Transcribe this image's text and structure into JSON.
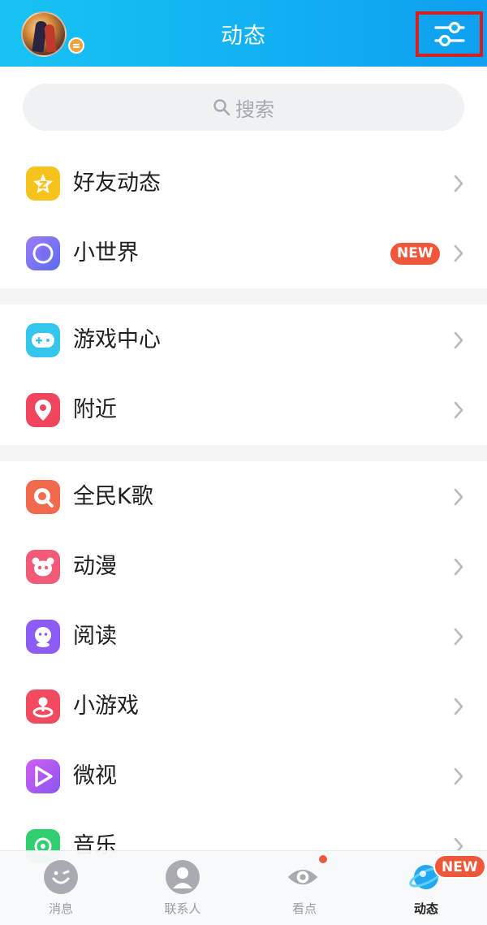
{
  "header": {
    "title": "动态"
  },
  "search": {
    "placeholder": "搜索"
  },
  "groups": [
    {
      "items": [
        {
          "label": "好友动态",
          "icon": "friend-feed-icon",
          "color": "#f6c21c"
        },
        {
          "label": "小世界",
          "icon": "small-world-icon",
          "color": "#7b6cf2",
          "badge": "NEW"
        }
      ]
    },
    {
      "items": [
        {
          "label": "游戏中心",
          "icon": "game-controller-icon",
          "color": "#35c6ee"
        },
        {
          "label": "附近",
          "icon": "location-pin-icon",
          "color": "#f0455c"
        }
      ]
    },
    {
      "items": [
        {
          "label": "全民K歌",
          "icon": "karaoke-icon",
          "color": "#f26a4d"
        },
        {
          "label": "动漫",
          "icon": "panda-icon",
          "color": "#f25a78"
        },
        {
          "label": "阅读",
          "icon": "reading-icon",
          "color": "#8b5cf6"
        },
        {
          "label": "小游戏",
          "icon": "mini-game-icon",
          "color": "#f24a5e"
        },
        {
          "label": "微视",
          "icon": "play-icon",
          "color": "#b25ef0"
        },
        {
          "label": "音乐",
          "icon": "music-icon",
          "color": "#2fce6e"
        }
      ]
    }
  ],
  "bottom_nav": {
    "items": [
      {
        "label": "消息",
        "icon": "message-icon"
      },
      {
        "label": "联系人",
        "icon": "contacts-icon"
      },
      {
        "label": "看点",
        "icon": "eye-icon"
      },
      {
        "label": "动态",
        "icon": "planet-icon",
        "active": true
      }
    ],
    "badge": "NEW"
  },
  "colors": {
    "header_gradient_start": "#17c3f3",
    "header_gradient_end": "#0fa0f0",
    "badge": "#f0573a",
    "highlight_box": "#d62020"
  }
}
